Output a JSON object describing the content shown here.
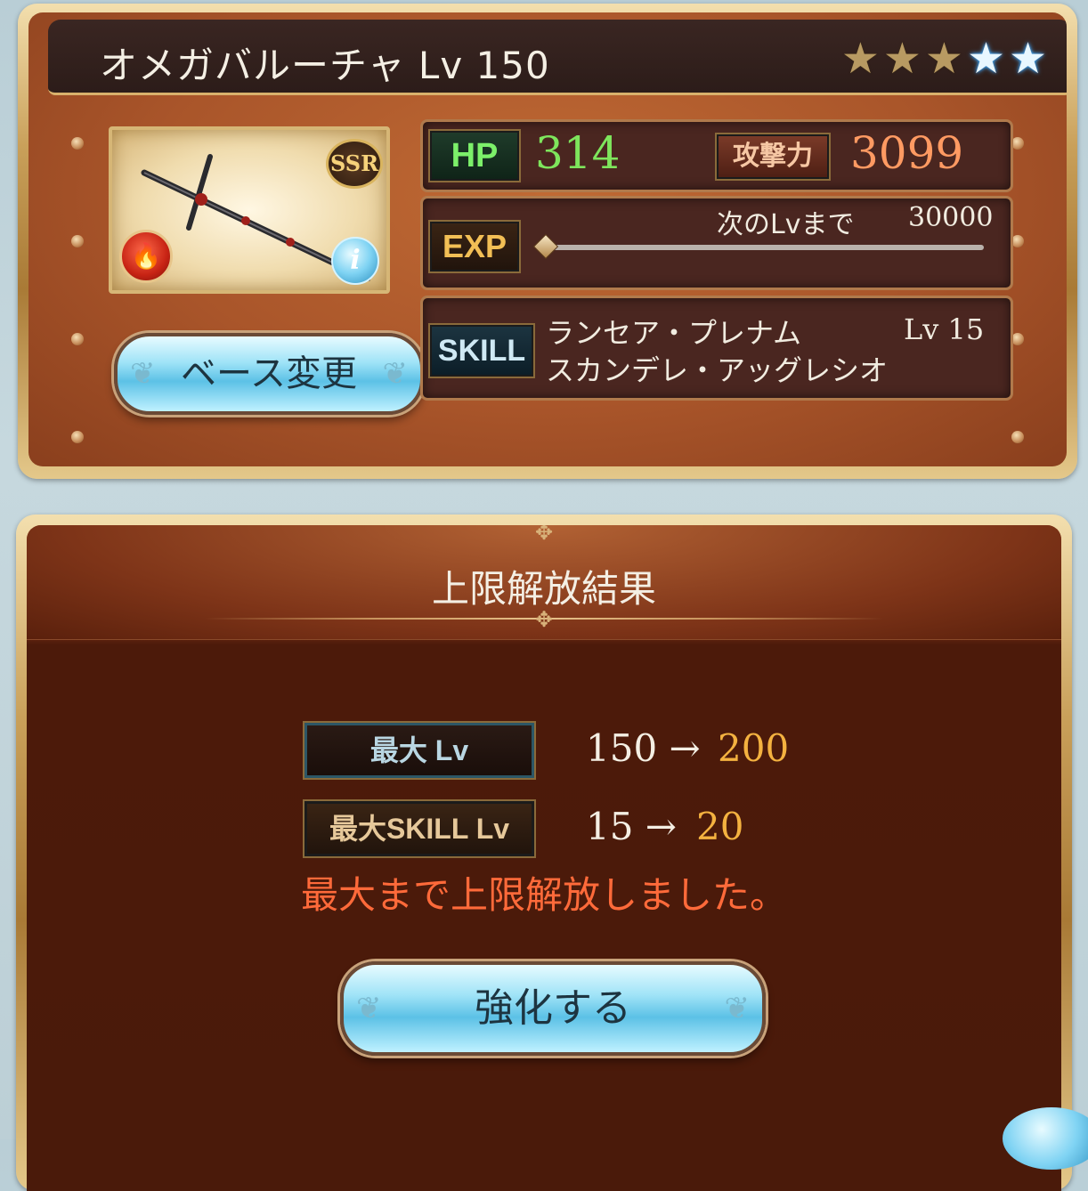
{
  "weapon": {
    "title": "オメガバルーチャ Lv 150",
    "rarity": "SSR",
    "element_icon": "fire-element-icon",
    "stars": {
      "total": 5,
      "uncapped_gold": 3,
      "uncapped_blue": 2
    }
  },
  "buttons": {
    "base_change": "ベース変更",
    "enhance": "強化する"
  },
  "stats": {
    "hp_label": "HP",
    "hp_value": "314",
    "atk_label": "攻撃力",
    "atk_value": "3099",
    "exp_label": "EXP",
    "next_lv_label": "次のLvまで",
    "next_lv_value": "30000",
    "exp_progress": 0.0
  },
  "skill": {
    "label": "SKILL",
    "name_line1": "ランセア・プレナム",
    "name_line2": "スカンデレ・アッグレシオ",
    "level": "Lv  15"
  },
  "result": {
    "title": "上限解放結果",
    "max_lv_label": "最大 Lv",
    "max_lv_from": "150 →",
    "max_lv_to": "200",
    "max_skill_label": "最大SKILL Lv",
    "max_skill_from": "15 →",
    "max_skill_to": "20",
    "message": "最大まで上限解放しました。"
  },
  "colors": {
    "hp": "#7ee55c",
    "atk": "#ff9a62",
    "upgrade_value": "#f4b240",
    "message": "#ff6a3a",
    "star_blue": "#4fb6ff"
  }
}
